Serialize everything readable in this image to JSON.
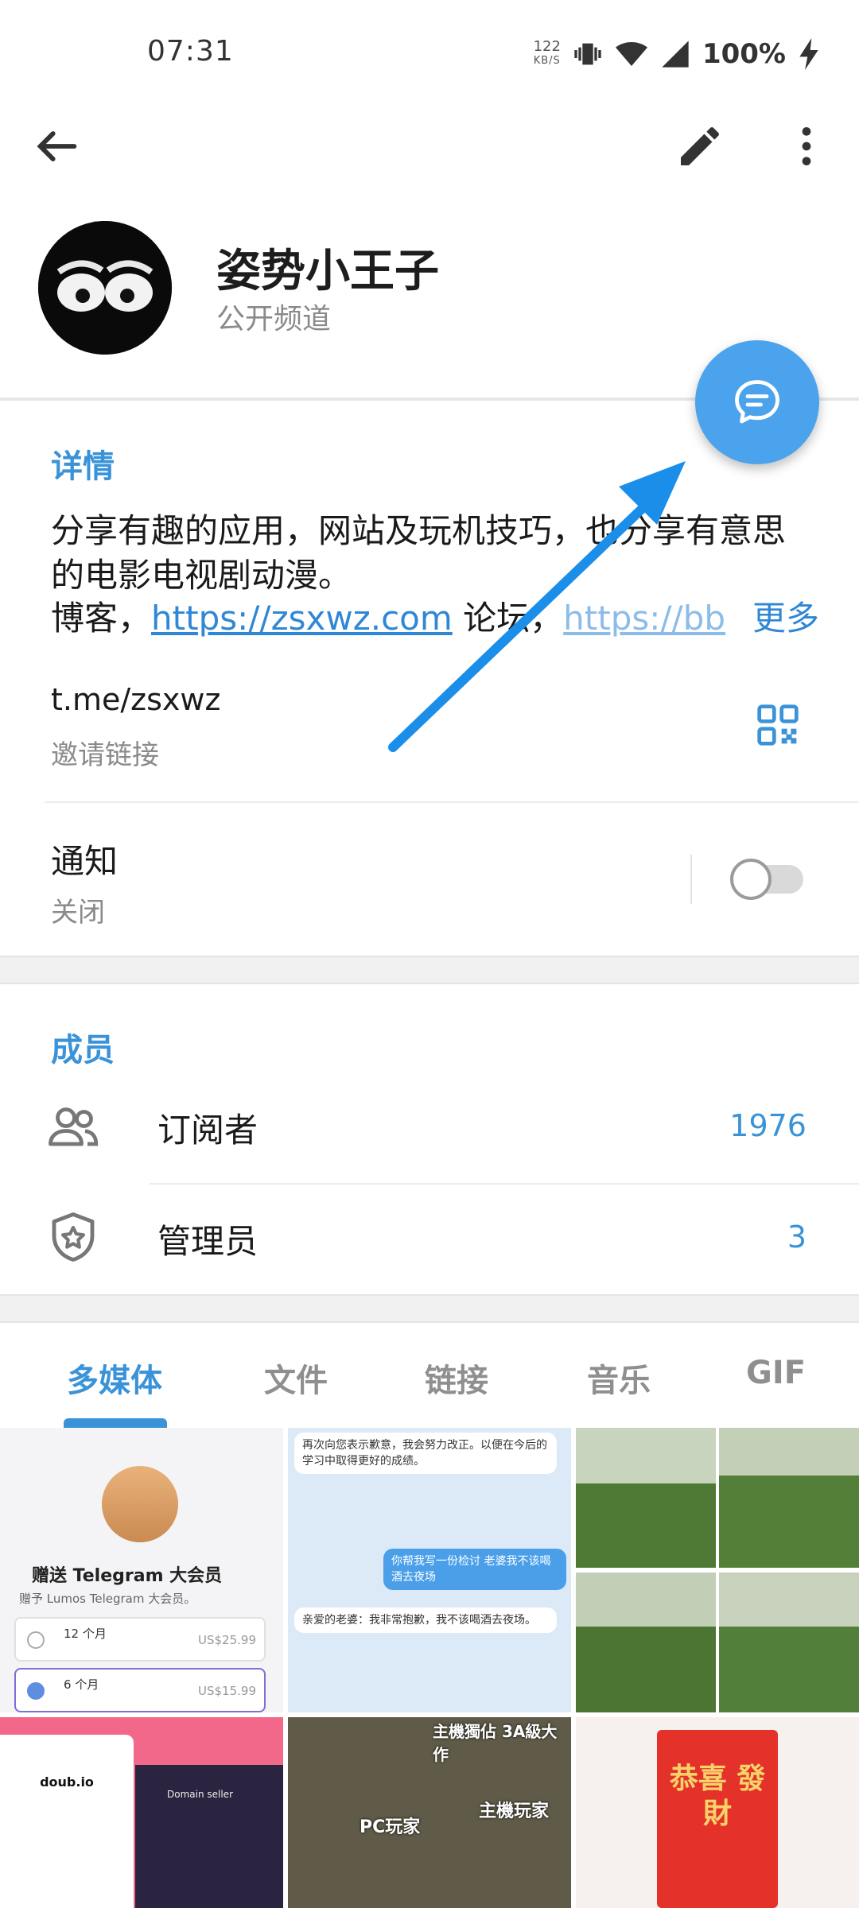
{
  "status_bar": {
    "time": "07:31",
    "net_speed": "122",
    "net_unit": "KB/S",
    "battery": "100%"
  },
  "header": {
    "channel_name": "姿势小王子",
    "channel_type": "公开频道"
  },
  "details": {
    "section_title": "详情",
    "about_line1": "分享有趣的应用，网站及玩机技巧，也分享有意思的电影电视剧动漫。",
    "about_line3_prefix": "博客，",
    "blog_link": "https://zsxwz.com",
    "forum_label": " 论坛，",
    "forum_link": "https://bb",
    "more": "更多",
    "username": "t.me/zsxwz",
    "username_sub": "邀请链接",
    "notifications_label": "通知",
    "notifications_state": "关闭"
  },
  "members": {
    "section_title": "成员",
    "subscribers_label": "订阅者",
    "subscribers_count": "1976",
    "admins_label": "管理员",
    "admins_count": "3"
  },
  "tabs": [
    "多媒体",
    "文件",
    "链接",
    "音乐",
    "GIF"
  ],
  "media": {
    "promo_title": "赠送 Telegram 大会员",
    "promo_sub": "赠予 Lumos Telegram 大会员。",
    "plan1_label": "12 个月",
    "plan1_price": "US$25.99",
    "plan2_label": "6 个月",
    "plan2_price": "US$15.99",
    "chat_msg1": "再次向您表示歉意，我会努力改正。以便在今后的学习中取得更好的成绩。",
    "chat_msg2": "你帮我写一份检讨 老婆我不该喝酒去夜场",
    "chat_msg3": "亲爱的老婆：我非常抱歉，我不该喝酒去夜场。",
    "meme_cap1": "主機獨佔 3A級大作",
    "meme_cap2": "主機玩家",
    "meme_cap3": "PC玩家",
    "domain_card": "doub.io",
    "domain_seller": "Domain seller",
    "envelope_text": "恭喜 發財"
  },
  "colors": {
    "accent": "#3a93d8",
    "fab": "#4aa3ec",
    "arrow": "#1a8ee8"
  }
}
